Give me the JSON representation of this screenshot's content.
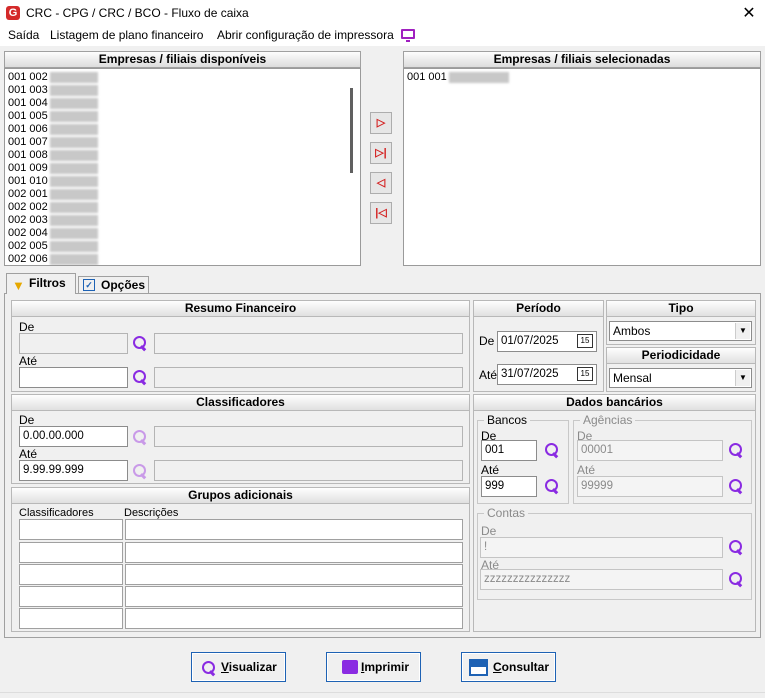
{
  "window": {
    "title": "CRC - CPG / CRC / BCO - Fluxo de caixa",
    "close_icon": "close-x-icon"
  },
  "menu": {
    "items": [
      "Saída",
      "Listagem de plano financeiro",
      "Abrir configuração de impressora"
    ]
  },
  "available": {
    "header": "Empresas / filiais disponíveis",
    "rows": [
      "001 002",
      "001 003",
      "001 004",
      "001 005",
      "001 006",
      "001 007",
      "001 008",
      "001 009",
      "001 010",
      "002 001",
      "002 002",
      "002 003",
      "002 004",
      "002 005",
      "002 006"
    ]
  },
  "selected": {
    "header": "Empresas / filiais selecionadas",
    "rows": [
      "001 001"
    ]
  },
  "tabs": {
    "filters": "Filtros",
    "options": "Opções"
  },
  "resumo": {
    "header": "Resumo Financeiro",
    "de_label": "De",
    "ate_label": "Até",
    "de_value": "",
    "ate_value": ""
  },
  "classificadores": {
    "header": "Classificadores",
    "de_label": "De",
    "ate_label": "Até",
    "de_value": "0.00.00.000",
    "ate_value": "9.99.99.999"
  },
  "grupos": {
    "header": "Grupos adicionais",
    "col_class": "Classificadores",
    "col_desc": "Descrições"
  },
  "periodo": {
    "header": "Período",
    "de_label": "De",
    "ate_label": "Até",
    "de_value": "01/07/2025",
    "ate_value": "31/07/2025",
    "cal_text": "15"
  },
  "tipo": {
    "header": "Tipo",
    "value": "Ambos"
  },
  "periodicidade": {
    "header": "Periodicidade",
    "value": "Mensal"
  },
  "dados": {
    "header": "Dados bancários",
    "bancos": {
      "legend": "Bancos",
      "de_label": "De",
      "ate_label": "Até",
      "de_value": "001",
      "ate_value": "999"
    },
    "agencias": {
      "legend": "Agências",
      "de_label": "De",
      "ate_label": "Até",
      "de_value": "00001",
      "ate_value": "99999"
    },
    "contas": {
      "legend": "Contas",
      "de_label": "De",
      "ate_label": "Até",
      "de_value": "!",
      "ate_value": "zzzzzzzzzzzzzzz"
    }
  },
  "buttons": {
    "visualizar_first": "V",
    "visualizar_rest": "isualizar",
    "imprimir_first": "I",
    "imprimir_rest": "mprimir",
    "consultar_first": "C",
    "consultar_rest": "onsultar"
  },
  "colors": {
    "accent_purple": "#8a2be2",
    "arrow_red": "#d42020",
    "button_border": "#1e62b4"
  }
}
